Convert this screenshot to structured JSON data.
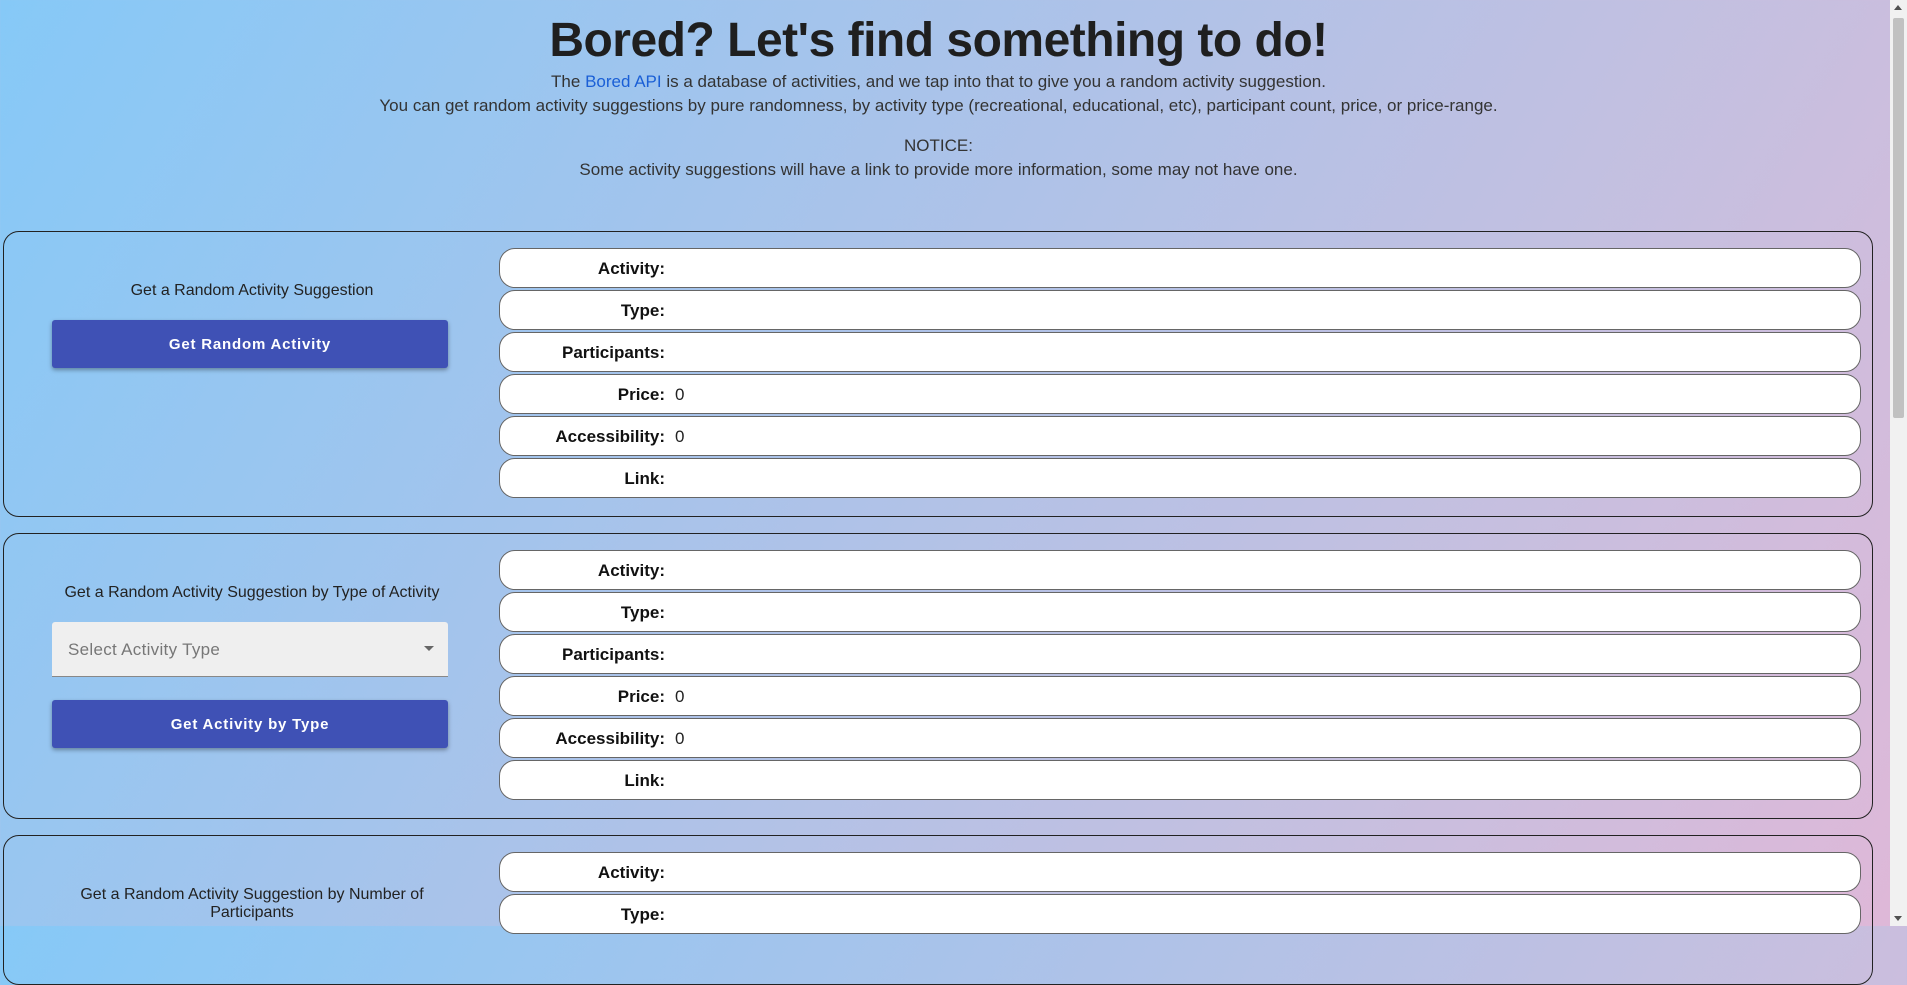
{
  "header": {
    "title": "Bored? Let's find something to do!",
    "intro_prefix": "The",
    "intro_link": "Bored API",
    "intro_suffix": "is a database of activities, and we tap into that to give you a random activity suggestion.",
    "intro_line2": "You can get random activity suggestions by pure randomness, by activity type (recreational, educational, etc), participant count, price, or price-range.",
    "notice_label": "NOTICE:",
    "notice_text": "Some activity suggestions will have a link to provide more information, some may not have one."
  },
  "field_labels": {
    "activity": "Activity:",
    "type": "Type:",
    "participants": "Participants:",
    "price": "Price:",
    "accessibility": "Accessibility:",
    "link": "Link:"
  },
  "cards": [
    {
      "title": "Get a Random Activity Suggestion",
      "button": "Get Random Activity",
      "values": {
        "activity": "",
        "type": "",
        "participants": "",
        "price": "0",
        "accessibility": "0",
        "link": ""
      }
    },
    {
      "title": "Get a Random Activity Suggestion by Type of Activity",
      "select_placeholder": "Select Activity Type",
      "button": "Get Activity by Type",
      "values": {
        "activity": "",
        "type": "",
        "participants": "",
        "price": "0",
        "accessibility": "0",
        "link": ""
      }
    },
    {
      "title": "Get a Random Activity Suggestion by Number of Participants",
      "values": {
        "activity": "",
        "type": ""
      }
    }
  ]
}
